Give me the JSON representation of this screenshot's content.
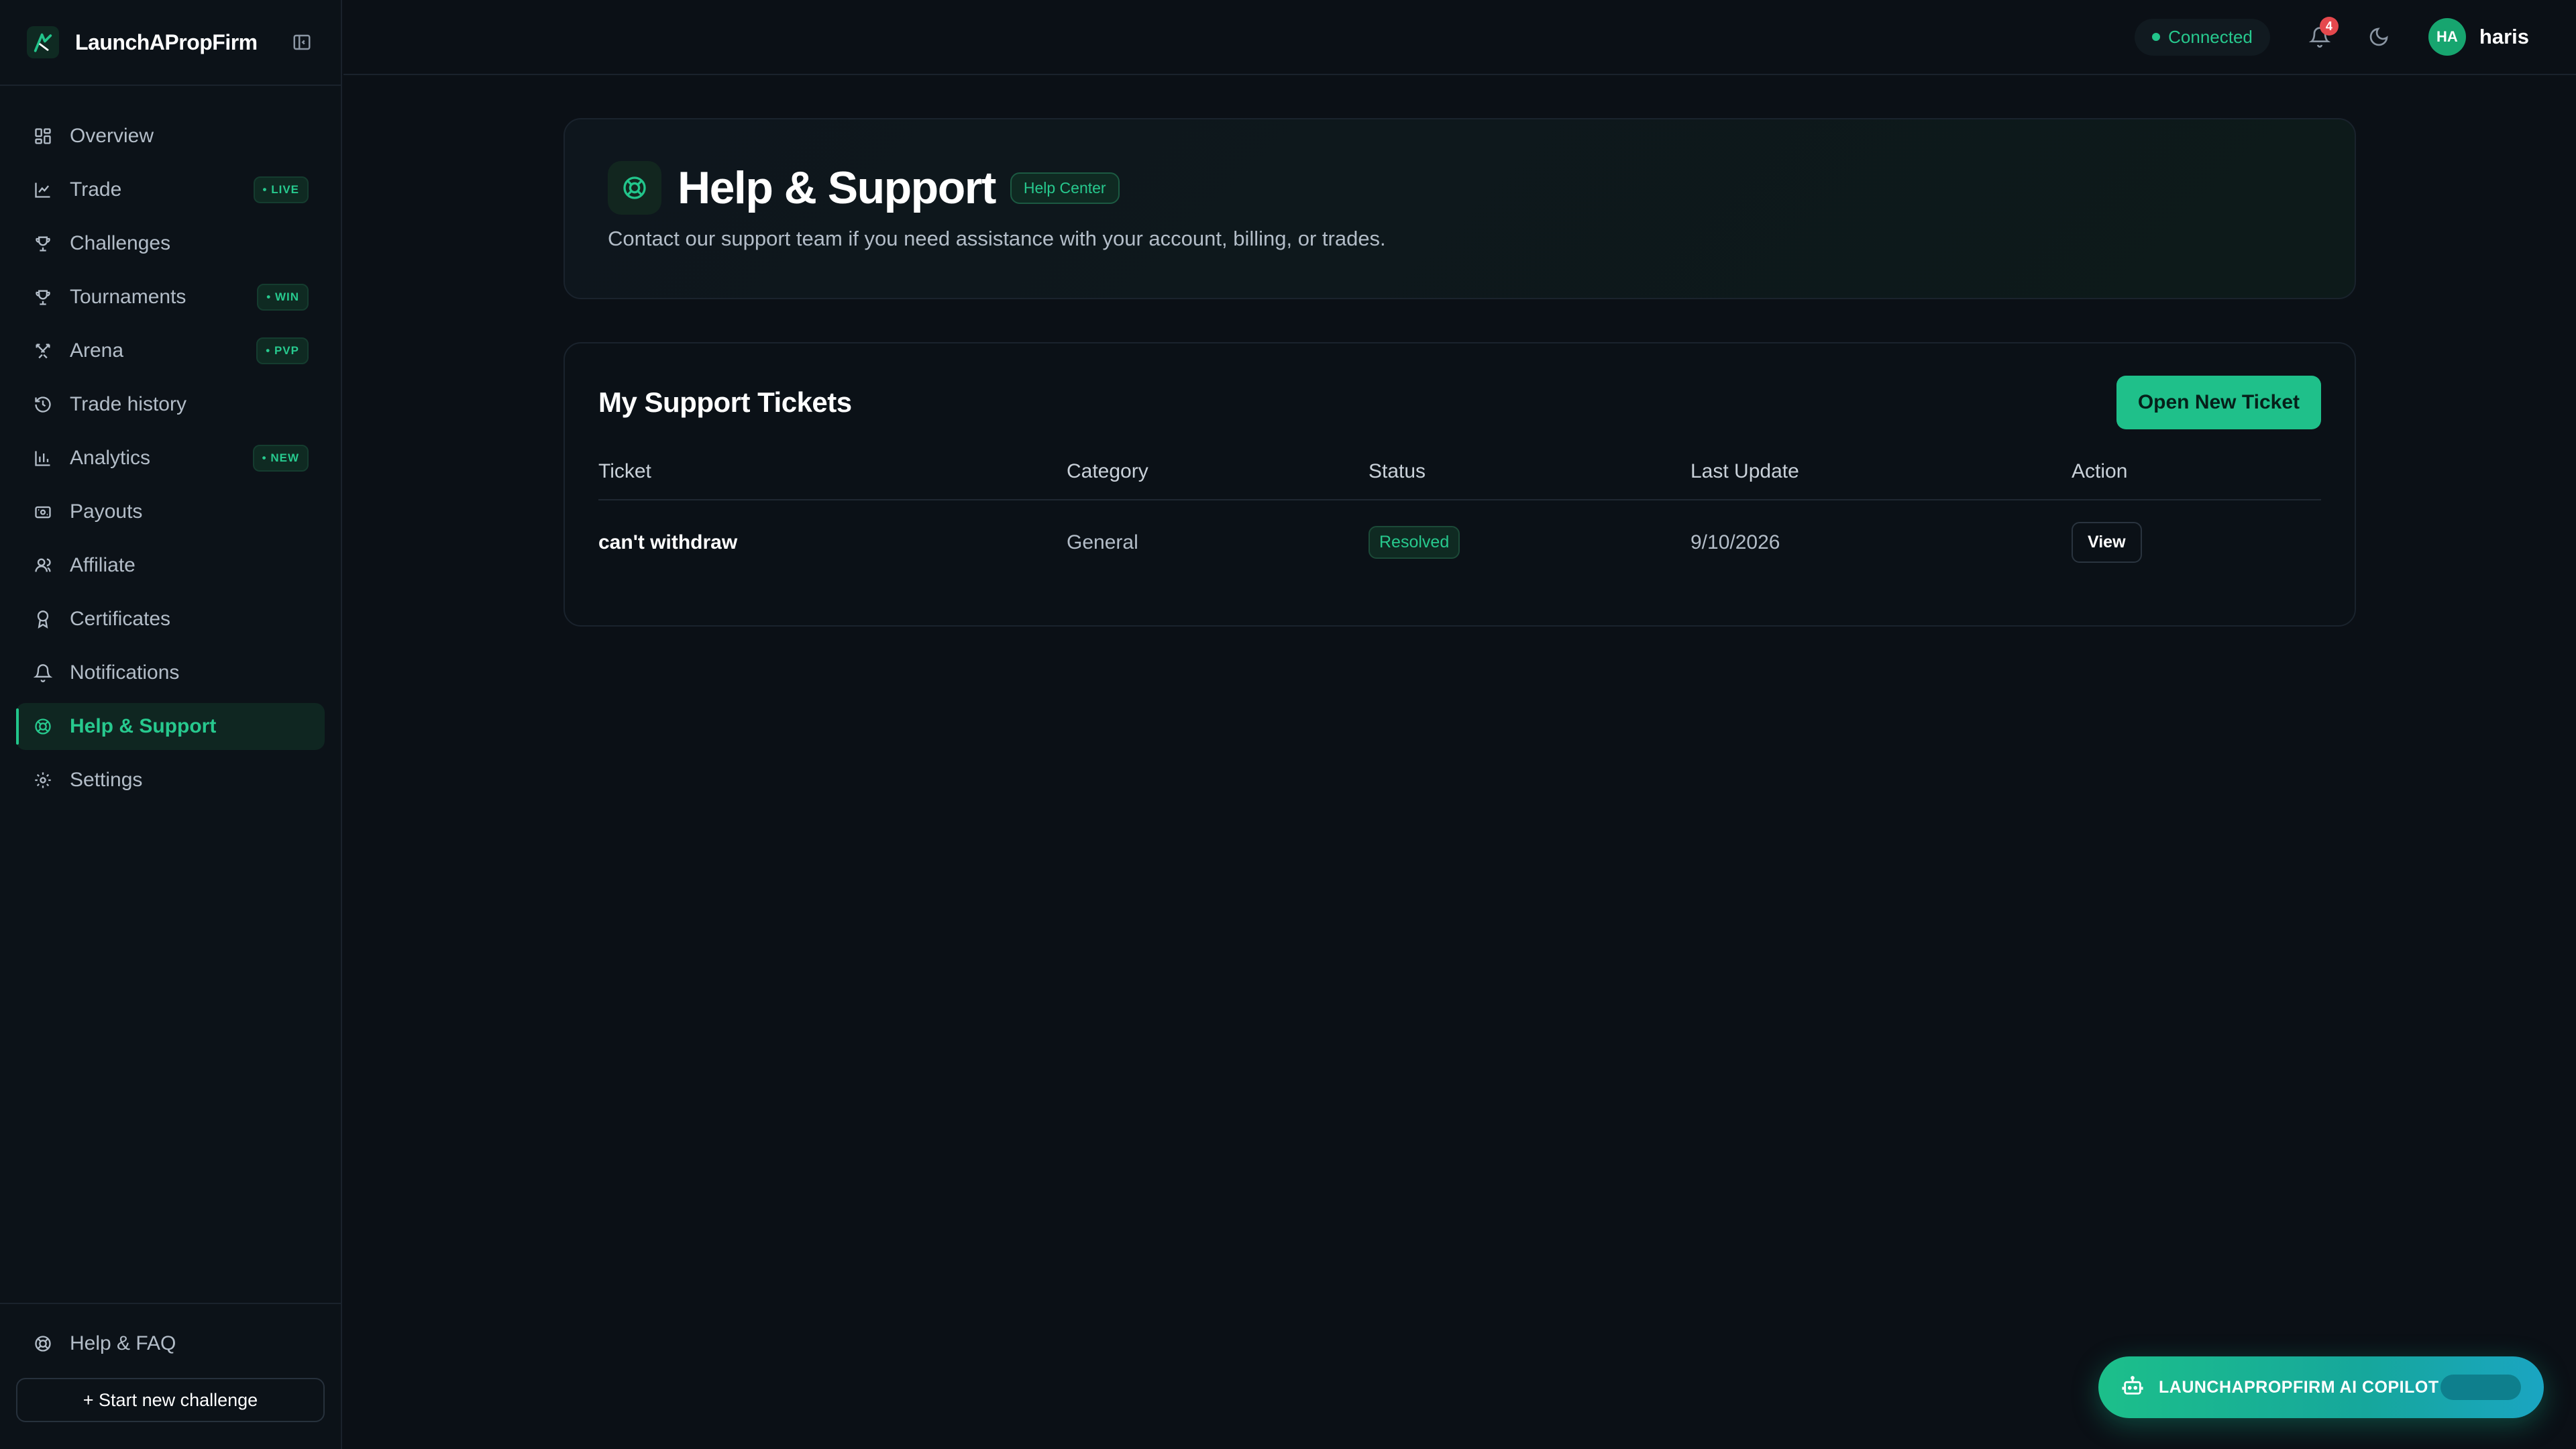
{
  "app": {
    "brand_name": "LaunchAPropFirm"
  },
  "sidebar": {
    "items": [
      {
        "label": "Overview",
        "icon": "grid-icon"
      },
      {
        "label": "Trade",
        "icon": "chart-icon",
        "badge": "• LIVE"
      },
      {
        "label": "Challenges",
        "icon": "trophy-icon"
      },
      {
        "label": "Tournaments",
        "icon": "trophy-icon",
        "badge": "• WIN"
      },
      {
        "label": "Arena",
        "icon": "swords-icon",
        "badge": "• PVP"
      },
      {
        "label": "Trade history",
        "icon": "history-icon"
      },
      {
        "label": "Analytics",
        "icon": "bar-chart-icon",
        "badge": "• NEW"
      },
      {
        "label": "Payouts",
        "icon": "wallet-icon"
      },
      {
        "label": "Affiliate",
        "icon": "users-icon"
      },
      {
        "label": "Certificates",
        "icon": "award-icon"
      },
      {
        "label": "Notifications",
        "icon": "bell-icon"
      },
      {
        "label": "Help & Support",
        "icon": "lifebuoy-icon",
        "active": true
      },
      {
        "label": "Settings",
        "icon": "gear-icon"
      }
    ],
    "help_faq": "Help & FAQ",
    "start_challenge": "+ Start new challenge"
  },
  "topbar": {
    "connection_status": "Connected",
    "notification_count": "4",
    "avatar_initials": "HA",
    "username": "haris"
  },
  "hero": {
    "title": "Help & Support",
    "tag": "Help Center",
    "subtitle": "Contact our support team if you need assistance with your account, billing, or trades."
  },
  "tickets": {
    "title": "My Support Tickets",
    "open_button": "Open New Ticket",
    "columns": [
      "Ticket",
      "Category",
      "Status",
      "Last Update",
      "Action"
    ],
    "rows": [
      {
        "ticket": "can't withdraw",
        "category": "General",
        "status": "Resolved",
        "last_update": "9/10/2026",
        "action": "View"
      }
    ]
  },
  "copilot": {
    "label": "LAUNCHAPROPFIRM AI COPILOT"
  },
  "colors": {
    "accent": "#22c58b",
    "background": "#0b1016",
    "notification_badge": "#e5484d"
  }
}
